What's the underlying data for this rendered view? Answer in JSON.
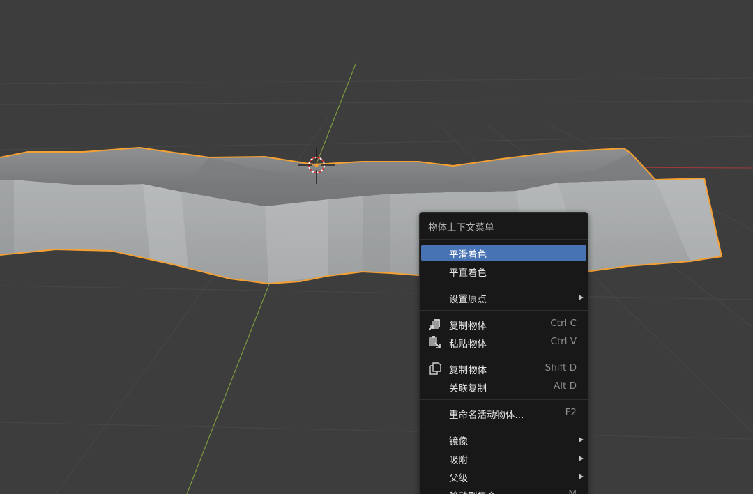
{
  "context_menu": {
    "title": "物体上下文菜单",
    "items": [
      {
        "label": "平滑着色",
        "shortcut": "",
        "active": true
      },
      {
        "label": "平直着色",
        "shortcut": ""
      },
      {
        "label": "设置原点",
        "shortcut": "",
        "submenu": true
      },
      {
        "label": "复制物体",
        "shortcut": "Ctrl C",
        "icon": "copy-to-buffer-icon"
      },
      {
        "label": "粘贴物体",
        "shortcut": "Ctrl V",
        "icon": "paste-from-buffer-icon"
      },
      {
        "label": "复制物体",
        "shortcut": "Shift D",
        "icon": "duplicate-icon"
      },
      {
        "label": "关联复制",
        "shortcut": "Alt D"
      },
      {
        "label": "重命名活动物体...",
        "shortcut": "F2"
      },
      {
        "label": "镜像",
        "shortcut": "",
        "submenu": true
      },
      {
        "label": "吸附",
        "shortcut": "",
        "submenu": true
      },
      {
        "label": "父级",
        "shortcut": "",
        "submenu": true
      },
      {
        "label": "移动到集合",
        "shortcut": "M"
      }
    ]
  },
  "colors": {
    "viewport_bg": "#3d3d3d",
    "selection_outline": "#f5a033",
    "menu_bg": "#181818",
    "menu_highlight": "#4772b3",
    "axis_y": "#7c9a3e",
    "axis_x": "#a33a3a"
  }
}
